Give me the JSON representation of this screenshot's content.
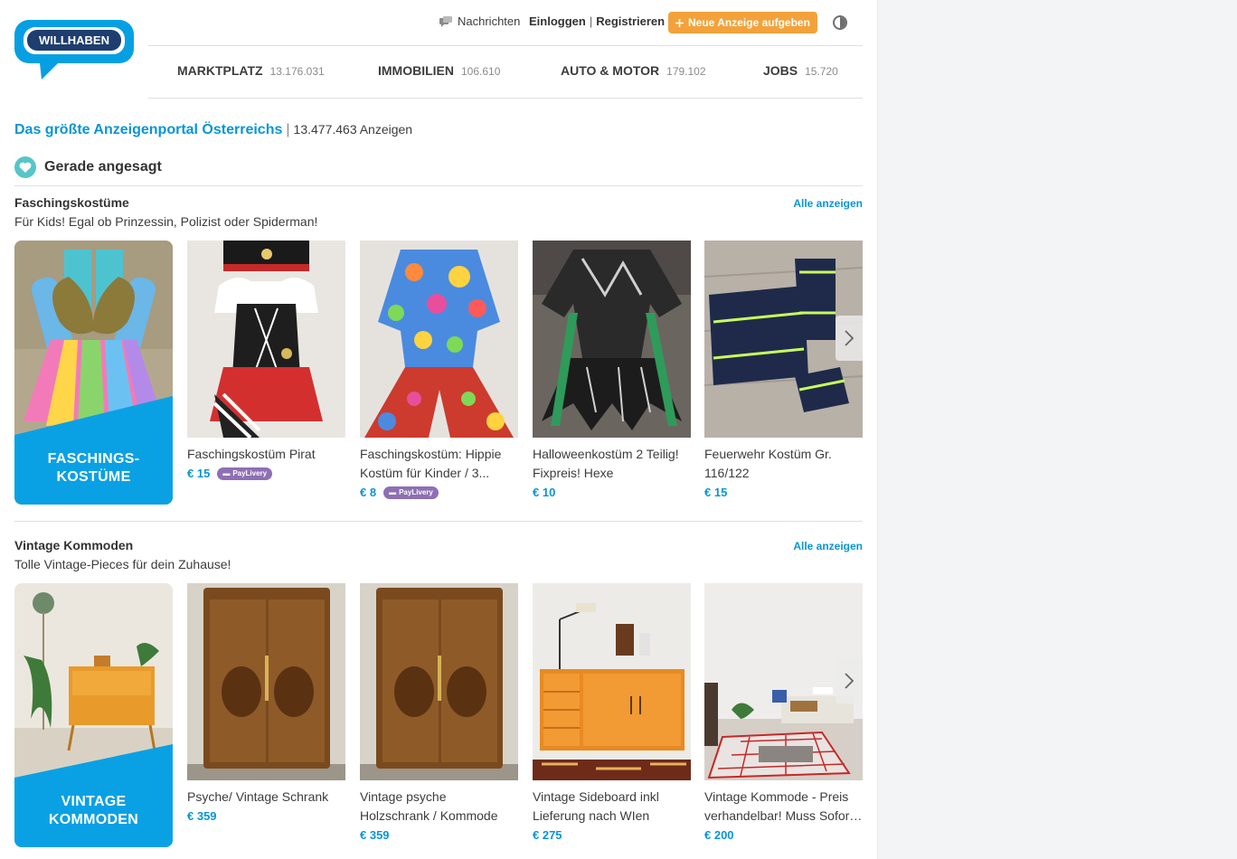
{
  "header": {
    "logo_text": "WILLHABEN",
    "messages_label": "Nachrichten",
    "login_label": "Einloggen",
    "separator": "|",
    "register_label": "Registrieren",
    "new_ad_label": "Neue Anzeige aufgeben"
  },
  "nav": [
    {
      "label": "MARKTPLATZ",
      "count": "13.176.031"
    },
    {
      "label": "IMMOBILIEN",
      "count": "106.610"
    },
    {
      "label": "AUTO & MOTOR",
      "count": "179.102"
    },
    {
      "label": "JOBS",
      "count": "15.720"
    }
  ],
  "headline": {
    "title": "Das größte Anzeigenportal Österreichs",
    "separator": "|",
    "count_text": "13.477.463 Anzeigen"
  },
  "trending_title": "Gerade angesagt",
  "sections": [
    {
      "title": "Faschingskostüme",
      "subtitle": "Für Kids! Egal ob Prinzessin, Polizist oder Spiderman!",
      "all_label": "Alle anzeigen",
      "promo_line1": "FASCHINGS-",
      "promo_line2": "KOSTÜME",
      "items": [
        {
          "title": "Faschingskostüm Pirat",
          "price": "€ 15",
          "badge": "PayLivery"
        },
        {
          "title": "Faschingskostüm: Hippie Kostüm für Kinder / 3...",
          "price": "€ 8",
          "badge": "PayLivery"
        },
        {
          "title": "Halloweenkostüm 2 Teilig! Fixpreis! Hexe",
          "price": "€ 10",
          "badge": ""
        },
        {
          "title": "Feuerwehr Kostüm Gr. 116/122",
          "price": "€ 15",
          "badge": ""
        }
      ]
    },
    {
      "title": "Vintage Kommoden",
      "subtitle": "Tolle Vintage-Pieces für dein Zuhause!",
      "all_label": "Alle anzeigen",
      "promo_line1": "VINTAGE",
      "promo_line2": "KOMMODEN",
      "items": [
        {
          "title": "Psyche/ Vintage Schrank",
          "price": "€ 359",
          "badge": ""
        },
        {
          "title": "Vintage psyche Holzschrank / Kommode",
          "price": "€ 359",
          "badge": ""
        },
        {
          "title": "Vintage Sideboard inkl Lieferung nach WIen",
          "price": "€ 275",
          "badge": ""
        },
        {
          "title": "Vintage Kommode - Preis verhandelbar! Muss Sofort weg",
          "price": "€ 200",
          "badge": ""
        }
      ]
    }
  ],
  "colors": {
    "brand": "#0895d6",
    "accent": "#f3a23b",
    "paylivery": "#8e6fb5",
    "trend": "#58c5c9"
  }
}
